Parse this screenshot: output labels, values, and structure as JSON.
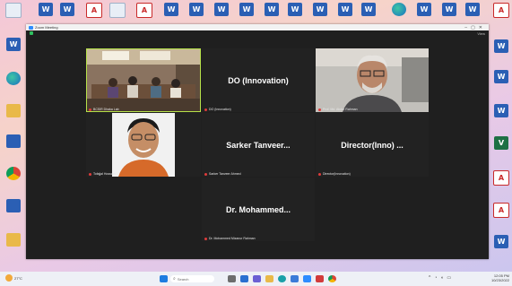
{
  "zoom": {
    "title": "Zoom Meeting",
    "view_label": "View",
    "tiles": [
      {
        "id": "t1",
        "name_big": "",
        "label": "BCSIR Dhaka Lab"
      },
      {
        "id": "t2",
        "name_big": "DO (Innovation)",
        "label": "DO (Innovation)"
      },
      {
        "id": "t3",
        "name_big": "",
        "label": "Prof. Md. Abdur Rahman"
      },
      {
        "id": "t4",
        "name_big": "",
        "label": "Tofajjal Hossain"
      },
      {
        "id": "t5",
        "name_big": "Sarker Tanveer...",
        "label": "Sarker Tanveer Ahmed"
      },
      {
        "id": "t6",
        "name_big": "Director(Inno) ...",
        "label": "Director(Innovation)"
      },
      {
        "id": "t7",
        "name_big": "Dr. Mohammed...",
        "label": "Dr. Mohammed Mizanur Rahman"
      }
    ]
  },
  "desktop": {
    "left_icons": [
      "Recycle Bin",
      "Word Doc",
      "Microsoft Edge",
      "Folder",
      "Screen",
      "Google Chrome",
      "Network",
      "Folder"
    ],
    "top_icons": [
      "Word",
      "PDF",
      "Desktop",
      "PDF",
      "Word",
      "Word",
      "Word",
      "Word",
      "Word",
      "Folder",
      "Word",
      "Word",
      "PDF",
      "Edge",
      "Word",
      "Word",
      "PDF"
    ],
    "right_icons": [
      "Microsoft Edge",
      "Word Doc",
      "Word Doc",
      "Excel",
      "PDF",
      "PDF",
      "Word Doc"
    ]
  },
  "taskbar": {
    "weather": "27°C",
    "search_placeholder": "Search",
    "clock_time": "12:05 PM",
    "clock_date": "10/23/2022"
  }
}
